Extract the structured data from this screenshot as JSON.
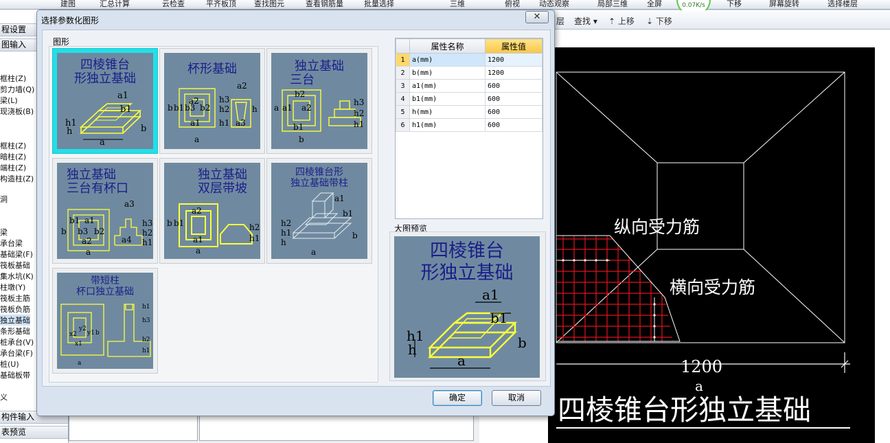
{
  "top_toolbar": {
    "items": [
      "建图",
      "汇总计算",
      "云检查",
      "平齐板顶",
      "查找图元",
      "查看钢筋量",
      "批量选择",
      "三维",
      "俯视",
      "动态观察",
      "局部三维",
      "全屏",
      "下移",
      "屏幕旋转",
      "选择楼层"
    ],
    "net_speed": "0.07K/s"
  },
  "view_toolbar": {
    "layer": "层",
    "find": "查找",
    "up": "上移",
    "down": "下移"
  },
  "sidebar": {
    "items": [
      "程设置",
      "图输入",
      "框柱(Z)",
      "剪力墙(Q)",
      "梁(L)",
      "现浇板(B)",
      "框柱(Z)",
      "暗柱(Z)",
      "端柱(Z)",
      "构造柱(Z)",
      "洞",
      "梁",
      "承台梁",
      "基础梁(F)",
      "筏板基础",
      "集水坑(K)",
      "柱墩(Y)",
      "筏板主筋",
      "筏板负筋",
      "独立基础",
      "条形基础",
      "桩承台(V)",
      "承台梁(F)",
      "桩(U)",
      "基础板带",
      "义",
      "构件输入",
      "表预览"
    ]
  },
  "dialog": {
    "title": "选择参数化图形",
    "close": "✕",
    "group_label": "图形",
    "shapes": [
      {
        "caption": [
          "四棱锥台",
          "形独立基础"
        ],
        "labels": [
          "a1",
          "b1",
          "h1",
          "h",
          "a",
          "b"
        ]
      },
      {
        "caption": [
          "杯形基础"
        ],
        "labels": [
          "a2",
          "h3",
          "h2",
          "h1",
          "b",
          "b1",
          "b3",
          "b2",
          "a1",
          "a2",
          "a3",
          "h",
          "a"
        ]
      },
      {
        "caption": [
          "独立基础",
          "三台"
        ],
        "labels": [
          "b2",
          "a2",
          "a1",
          "b1",
          "h3",
          "h2",
          "h1",
          "a",
          "b"
        ]
      },
      {
        "caption": [
          "独立基础",
          "三台有杯口"
        ],
        "labels": [
          "a3",
          "b1",
          "a1",
          "b3",
          "b2",
          "a2",
          "h3",
          "h2",
          "h1",
          "a4",
          "b",
          "a"
        ]
      },
      {
        "caption": [
          "独立基础",
          "双层带坡"
        ],
        "labels": [
          "a2",
          "b1",
          "b",
          "a1",
          "h2",
          "h1",
          "a"
        ]
      },
      {
        "caption": [
          "四棱锥台形",
          "独立基础带柱"
        ],
        "labels": [
          "a1",
          "b1",
          "h2",
          "h1",
          "h",
          "b",
          "a"
        ]
      },
      {
        "caption": [
          "带短柱",
          "杯口独立基础"
        ],
        "labels": [
          "h1",
          "h3",
          "y2",
          "y1",
          "b",
          "x2",
          "x1",
          "h2",
          "h1",
          "a"
        ]
      }
    ],
    "properties": {
      "headers": [
        "属性名称",
        "属性值"
      ],
      "rows": [
        {
          "index": "1",
          "name": "a(mm)",
          "value": "1200"
        },
        {
          "index": "2",
          "name": "b(mm)",
          "value": "1200"
        },
        {
          "index": "3",
          "name": "a1(mm)",
          "value": "600"
        },
        {
          "index": "4",
          "name": "b1(mm)",
          "value": "600"
        },
        {
          "index": "5",
          "name": "h(mm)",
          "value": "600"
        },
        {
          "index": "6",
          "name": "h1(mm)",
          "value": "600"
        }
      ]
    },
    "preview_label": "大图预览",
    "preview_caption": [
      "四棱锥台",
      "形独立基础"
    ],
    "preview_labels": [
      "a1",
      "b1",
      "h1",
      "h",
      "a",
      "b"
    ],
    "ok": "确定",
    "cancel": "取消"
  },
  "cad": {
    "label_long": "纵向受力筋",
    "label_trans": "横向受力筋",
    "dim_value": "1200",
    "dim_name": "a",
    "title": "四棱锥台形独立基础"
  }
}
